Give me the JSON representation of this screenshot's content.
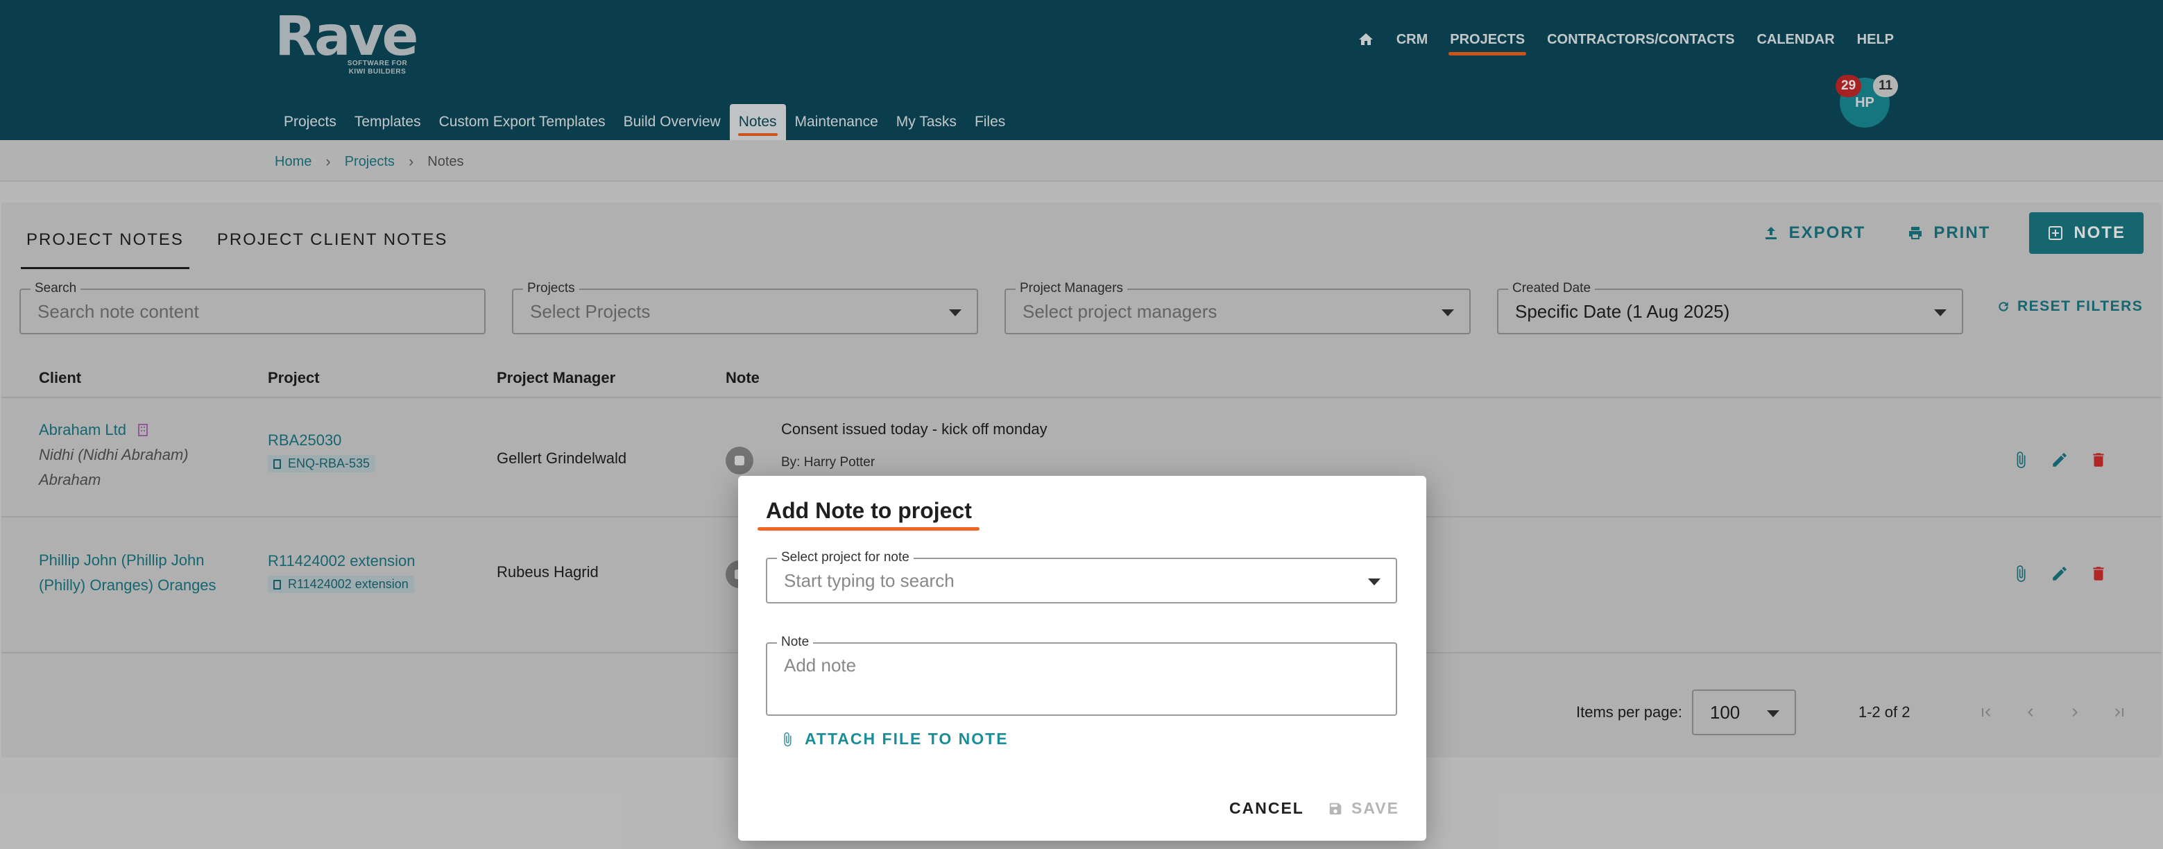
{
  "brand": {
    "name": "Rave",
    "tagline": "SOFTWARE FOR KIWI BUILDERS"
  },
  "topnav": {
    "items": [
      "CRM",
      "PROJECTS",
      "CONTRACTORS/CONTACTS",
      "CALENDAR",
      "HELP"
    ],
    "active": "PROJECTS"
  },
  "user": {
    "initials": "HP",
    "badge_red": "29",
    "badge_grey": "11"
  },
  "subnav": {
    "items": [
      "Projects",
      "Templates",
      "Custom Export Templates",
      "Build Overview",
      "Notes",
      "Maintenance",
      "My Tasks",
      "Files"
    ],
    "active": "Notes"
  },
  "breadcrumb": [
    "Home",
    "Projects",
    "Notes"
  ],
  "tabs": [
    "PROJECT NOTES",
    "PROJECT CLIENT NOTES"
  ],
  "actions": {
    "export": "EXPORT",
    "print": "PRINT",
    "note": "NOTE"
  },
  "filters": {
    "search": {
      "label": "Search",
      "placeholder": "Search note content"
    },
    "projects": {
      "label": "Projects",
      "placeholder": "Select Projects"
    },
    "managers": {
      "label": "Project Managers",
      "placeholder": "Select project managers"
    },
    "created": {
      "label": "Created Date",
      "value": "Specific Date (1 Aug 2025)"
    },
    "reset": "RESET FILTERS"
  },
  "table": {
    "headers": [
      "Client",
      "Project",
      "Project Manager",
      "Note"
    ],
    "rows": [
      {
        "client": "Abraham Ltd",
        "client_sub1": "Nidhi (Nidhi Abraham)",
        "client_sub2": "Abraham",
        "project": "RBA25030",
        "project_chip": "ENQ-RBA-535",
        "manager": "Gellert Grindelwald",
        "note": "Consent issued today - kick off monday",
        "note_by": "By: Harry Potter"
      },
      {
        "client_line1": "Phillip John (Phillip John",
        "client_line2": "(Philly) Oranges) Oranges",
        "project": "R11424002 extension",
        "project_chip": "R11424002 extension",
        "manager": "Rubeus Hagrid"
      }
    ]
  },
  "pagination": {
    "label": "Items per page:",
    "per_page": "100",
    "range": "1-2 of 2"
  },
  "dialog": {
    "title": "Add Note to project",
    "project_label": "Select project for note",
    "project_placeholder": "Start typing to search",
    "note_label": "Note",
    "note_placeholder": "Add note",
    "attach": "ATTACH FILE TO NOTE",
    "cancel": "CANCEL",
    "save": "SAVE"
  },
  "colors": {
    "header": "#0e4b5b",
    "accent": "#1b7a86",
    "underline": "#f26522",
    "delete": "#d32f2f",
    "badge_red": "#c62828"
  },
  "icons": [
    "home-icon",
    "export-icon",
    "print-icon",
    "add-note-icon",
    "reset-icon",
    "building-icon",
    "document-icon",
    "note-status-icon",
    "attach-icon",
    "edit-icon",
    "delete-icon",
    "first-page-icon",
    "prev-page-icon",
    "next-page-icon",
    "last-page-icon",
    "save-icon",
    "chevron-down-icon"
  ]
}
